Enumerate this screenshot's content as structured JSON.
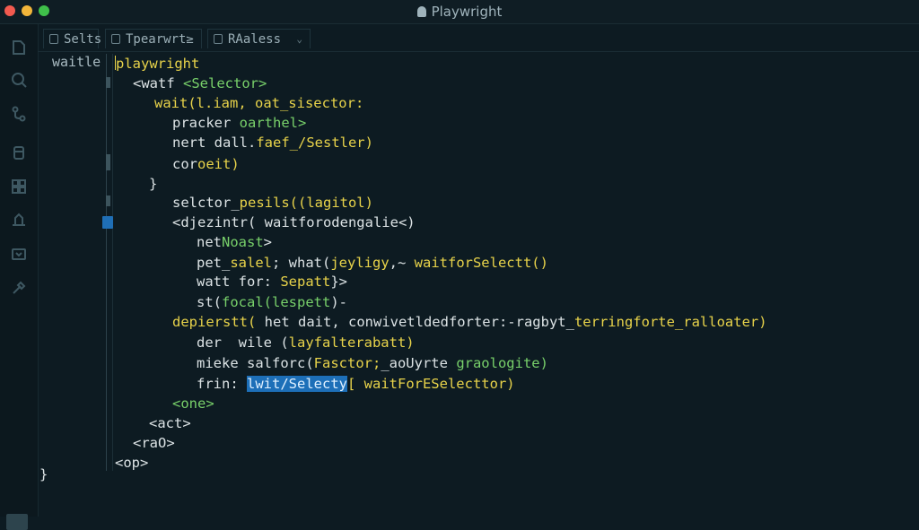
{
  "window": {
    "title": "Playwright"
  },
  "tabs": [
    {
      "label": "Selts"
    },
    {
      "label": "Tpearwrt≥"
    },
    {
      "label": "RAaless"
    }
  ],
  "gutter": {
    "label": "waitle"
  },
  "code": {
    "l1": "playwright",
    "l2a": "<watf ",
    "l2b": "<Selector>",
    "l3a": "wait(l.iam, ",
    "l3b": "oat_sisector:",
    "l4a": "pracker ",
    "l4b": "oarthel>",
    "l5a": "nert dall.",
    "l5b": "faef_/Sestler)",
    "l6a": "cor",
    "l6b": "oeit)",
    "l7": "}",
    "l8a": "selctor_",
    "l8b": "pesils",
    "l8c": "((lagitol)",
    "l9": "<djezintr( waitforodengalie<)",
    "l10a": "net",
    "l10b": "Noast",
    "l10c": ">",
    "l11a": "pet_",
    "l11b": "salel",
    "l11c": "; what(",
    "l11d": "jeyligy",
    "l11e": ",~ ",
    "l11f": "waitforSelectt()",
    "l12a": "watt for: ",
    "l12b": "Sepatt",
    "l12c": "}>",
    "l13a": "st(",
    "l13b": "focal(lespett",
    "l13c": ")-",
    "l14a": "depierstt(",
    "l14b": " het dait,",
    "l14c": " conwivetldedforter:-ragbyt_",
    "l14d": "terringforte_ralloater)",
    "l15a": "der  wile (",
    "l15b": "layfalterabatt)",
    "l16a": "mieke salforc(",
    "l16b": "Fasctor;",
    "l16c": "_aoUyrte ",
    "l16d": "graologite)",
    "l17a": "frin: ",
    "l17b": "lwit/Selecty",
    "l17c": "[ ",
    "l17d": "waitForESelecttor)",
    "l18": "<one>",
    "l19": "<act>",
    "l20": "<raO>",
    "l21": "<op>",
    "l22": "}"
  },
  "colors": {
    "keyword": "#e8d34a",
    "string": "#78d06a",
    "selection": "#1d6fb8",
    "background": "#0d1b22"
  }
}
